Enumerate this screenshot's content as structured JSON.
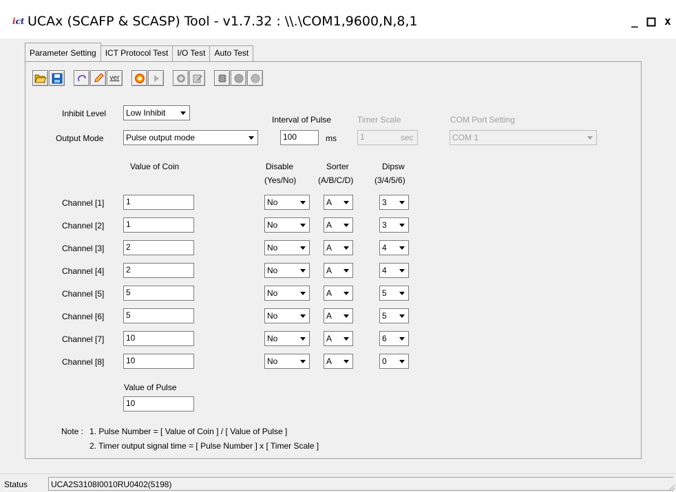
{
  "window": {
    "title": "UCAx (SCAFP & SCASP) Tool - v1.7.32 : \\\\.\\COM1,9600,N,8,1",
    "minimize": "_",
    "maximize": "□",
    "close": "x"
  },
  "tabs": [
    {
      "label": "Parameter Setting",
      "active": true
    },
    {
      "label": "ICT Protocol Test",
      "active": false
    },
    {
      "label": "I/O Test",
      "active": false
    },
    {
      "label": "Auto Test",
      "active": false
    }
  ],
  "toolbar": {
    "icons": [
      "open-folder-icon",
      "save-disk-icon",
      "reset-icon",
      "edit-pencil-icon",
      "version-icon",
      "settings-gear-icon",
      "play-icon",
      "stop-icon",
      "write-icon",
      "chip-icon",
      "record-icon",
      "record-disabled-icon"
    ],
    "ver_label": "ver"
  },
  "settings": {
    "inhibit_label": "Inhibit Level",
    "inhibit_value": "Low Inhibit",
    "output_label": "Output Mode",
    "output_value": "Pulse output mode",
    "interval_label": "Interval of Pulse",
    "interval_value": "100",
    "interval_unit": "ms",
    "timer_label": "Timer Scale",
    "timer_value": "1",
    "timer_unit": "sec",
    "com_label": "COM Port Setting",
    "com_value": "COM 1"
  },
  "columns": {
    "coin": "Value of Coin",
    "disable": "Disable",
    "disable_sub": "(Yes/No)",
    "sorter": "Sorter",
    "sorter_sub": "(A/B/C/D)",
    "dipsw": "Dipsw",
    "dipsw_sub": "(3/4/5/6)"
  },
  "channels": [
    {
      "label": "Channel [1]",
      "coin": "1",
      "disable": "No",
      "sorter": "A",
      "dipsw": "3"
    },
    {
      "label": "Channel [2]",
      "coin": "1",
      "disable": "No",
      "sorter": "A",
      "dipsw": "3"
    },
    {
      "label": "Channel [3]",
      "coin": "2",
      "disable": "No",
      "sorter": "A",
      "dipsw": "4"
    },
    {
      "label": "Channel [4]",
      "coin": "2",
      "disable": "No",
      "sorter": "A",
      "dipsw": "4"
    },
    {
      "label": "Channel [5]",
      "coin": "5",
      "disable": "No",
      "sorter": "A",
      "dipsw": "5"
    },
    {
      "label": "Channel [6]",
      "coin": "5",
      "disable": "No",
      "sorter": "A",
      "dipsw": "5"
    },
    {
      "label": "Channel [7]",
      "coin": "10",
      "disable": "No",
      "sorter": "A",
      "dipsw": "6"
    },
    {
      "label": "Channel [8]",
      "coin": "10",
      "disable": "No",
      "sorter": "A",
      "dipsw": "0"
    }
  ],
  "pulse": {
    "label": "Value of Pulse",
    "value": "10"
  },
  "note": {
    "prefix": "Note :",
    "line1": "1. Pulse Number  =  [ Value of Coin ]  /  [ Value of Pulse ]",
    "line2": "2. Timer output signal time  =  [ Pulse Number ]  x  [ Timer Scale ]"
  },
  "status": {
    "label": "Status",
    "value": "UCA2S3108I0010RU0402(5198)"
  },
  "colors": {
    "window_bg": "#f0f0f0",
    "field_bg": "#ffffff",
    "disabled_text": "#a0a0a0"
  }
}
